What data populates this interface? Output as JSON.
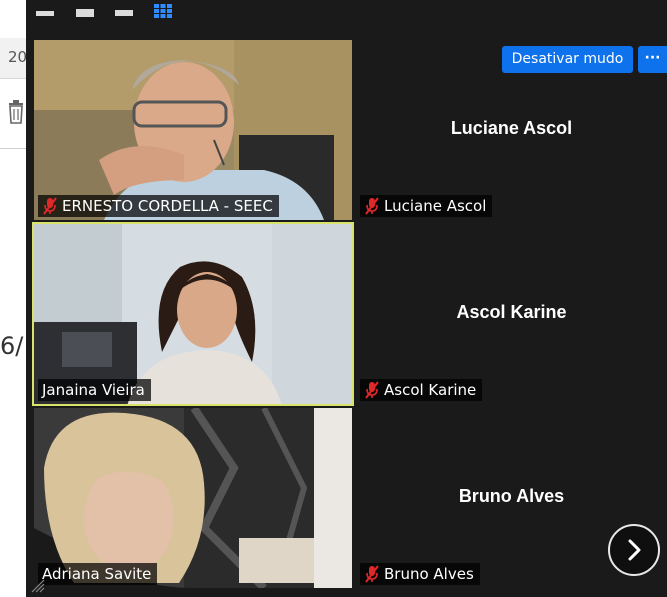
{
  "background": {
    "tab_text": "20",
    "side_text": "6/"
  },
  "controls": {
    "unmute_label": "Desativar mudo",
    "more_label": "···"
  },
  "participants": [
    {
      "name": "ERNESTO CORDELLA  -  SEEC",
      "muted": true,
      "video": true
    },
    {
      "name": "Luciane Ascol",
      "muted": true,
      "video": false
    },
    {
      "name": "Janaina Vieira",
      "muted": false,
      "video": true,
      "active": true
    },
    {
      "name": "Ascol Karine",
      "muted": true,
      "video": false
    },
    {
      "name": "Adriana Savite",
      "muted": false,
      "video": true
    },
    {
      "name": "Bruno Alves",
      "muted": true,
      "video": false
    }
  ],
  "colors": {
    "accent": "#0e72ed",
    "active_speaker": "#d8e36a",
    "muted_icon": "#e02828"
  }
}
